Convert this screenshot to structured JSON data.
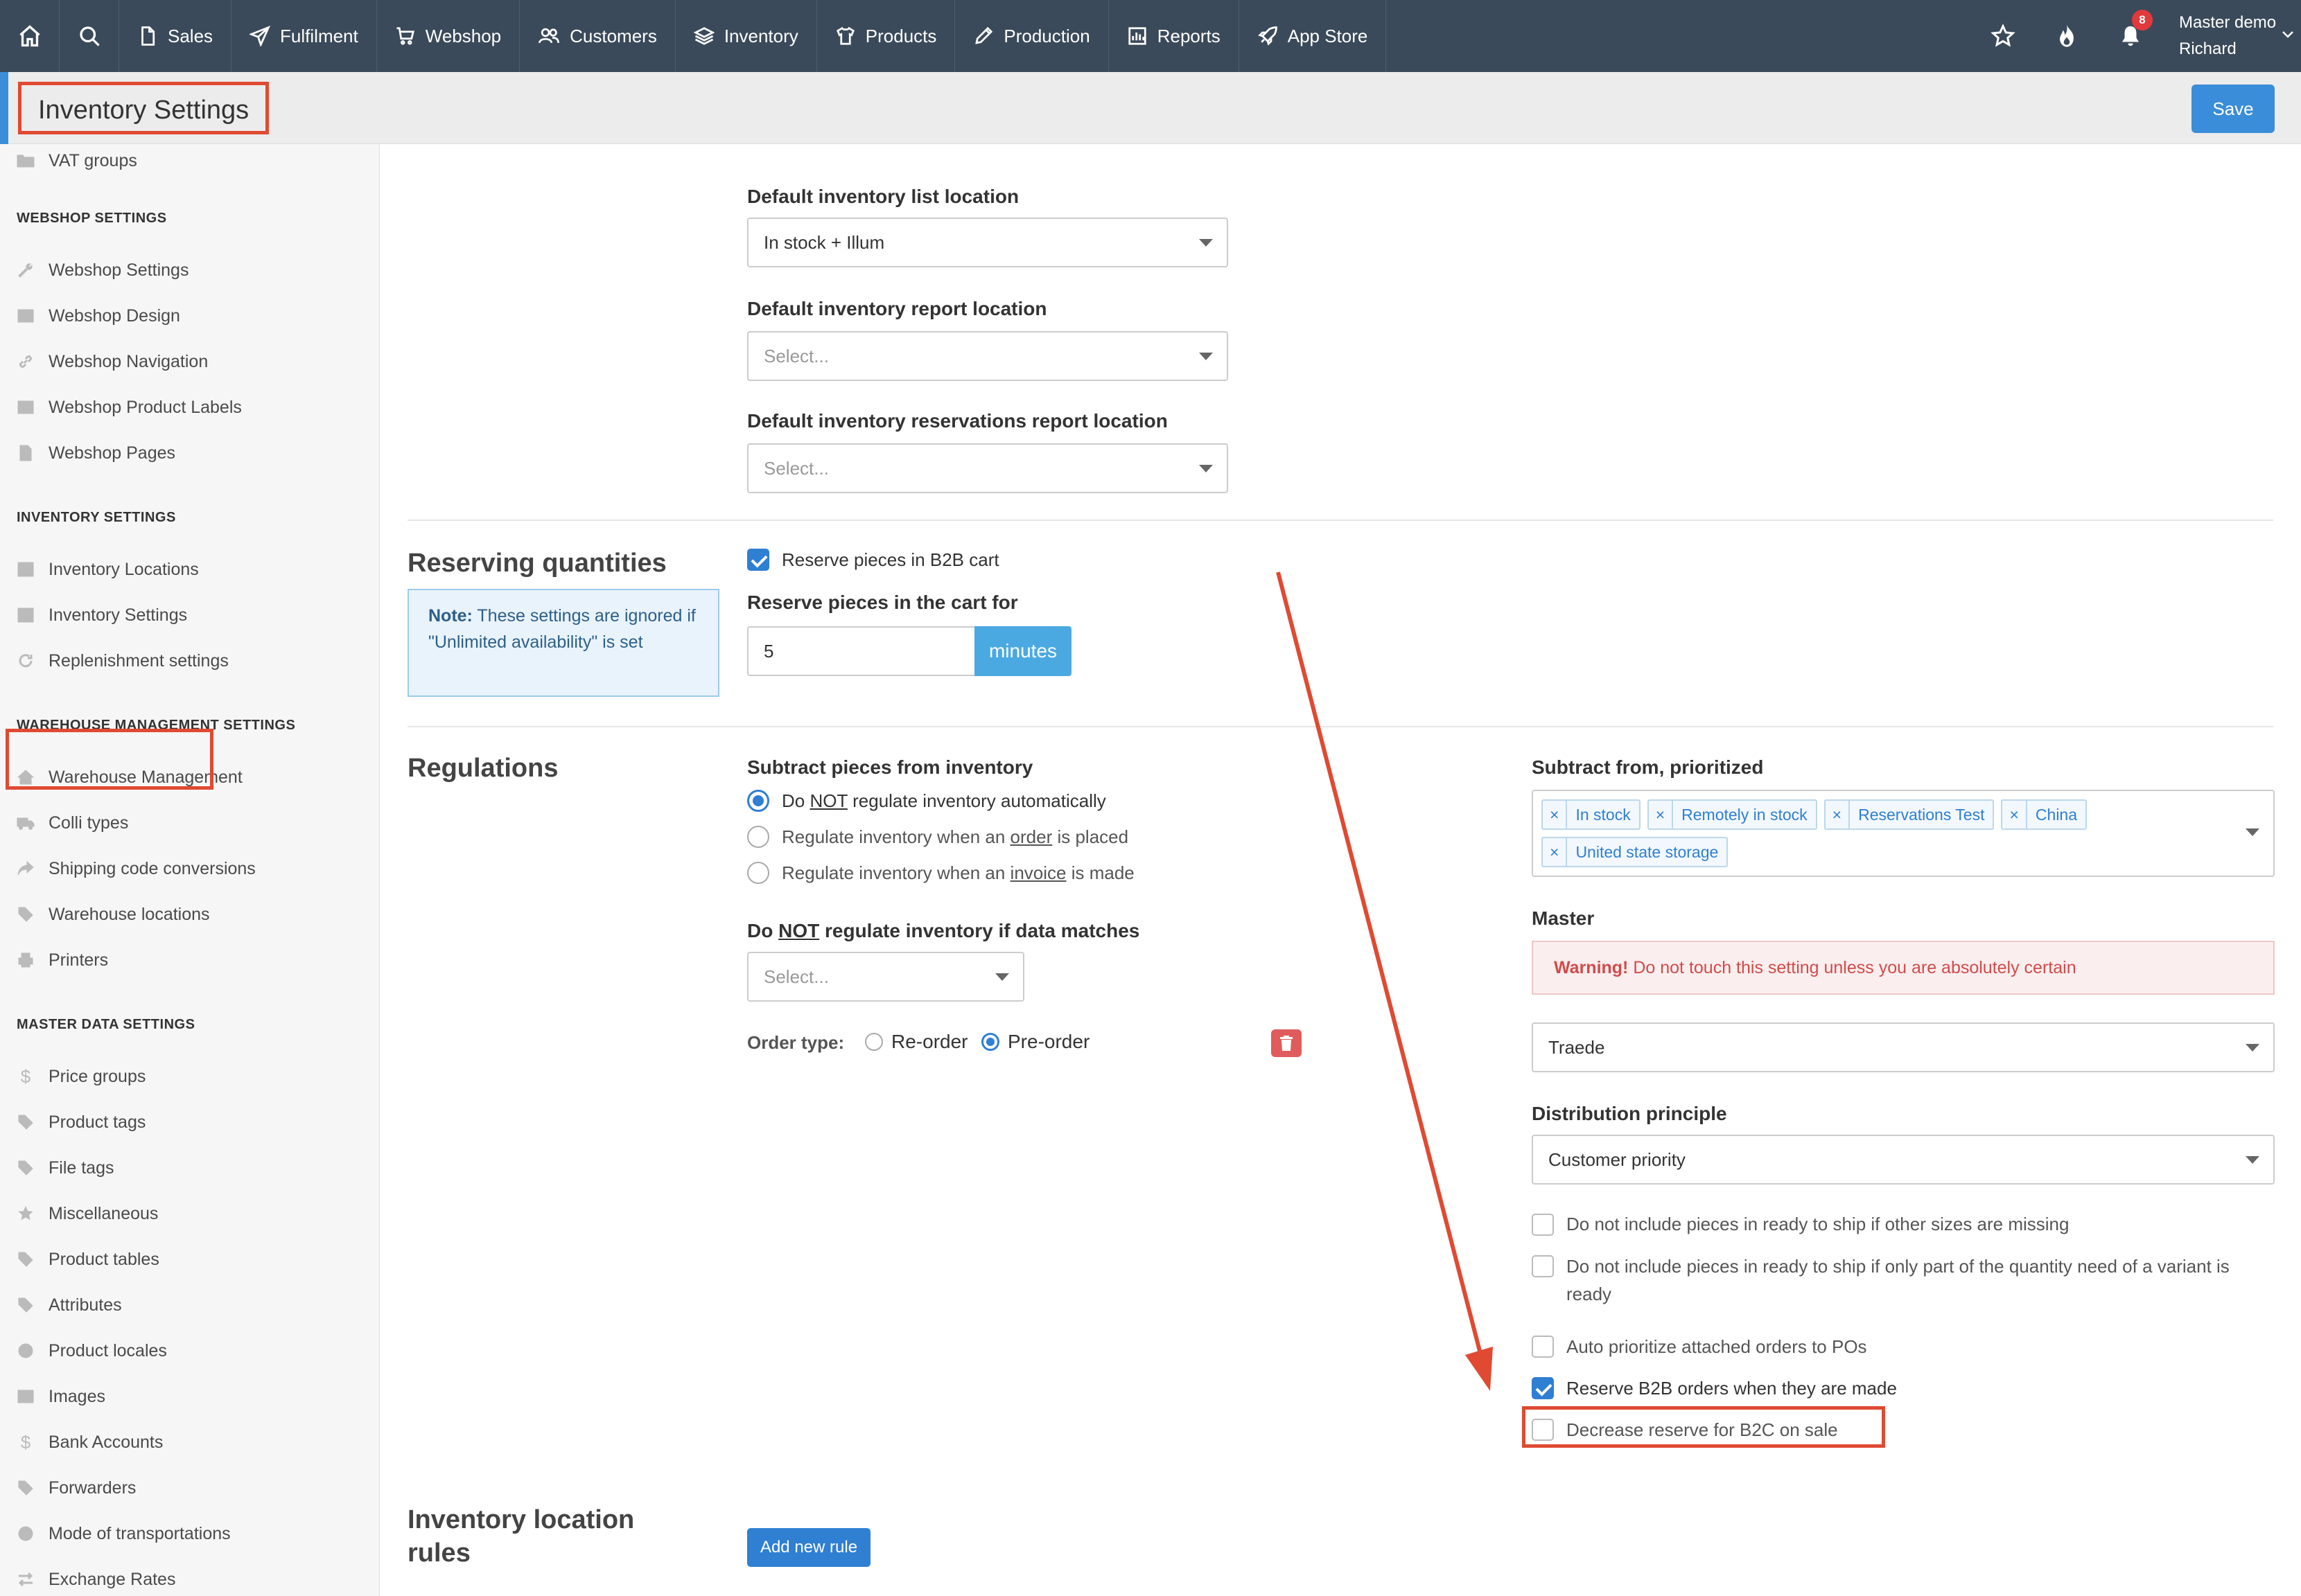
{
  "nav": {
    "items": [
      {
        "label": "Sales",
        "icon": "document-icon"
      },
      {
        "label": "Fulfilment",
        "icon": "send-icon"
      },
      {
        "label": "Webshop",
        "icon": "cart-icon"
      },
      {
        "label": "Customers",
        "icon": "users-icon"
      },
      {
        "label": "Inventory",
        "icon": "layers-icon"
      },
      {
        "label": "Products",
        "icon": "shirt-icon"
      },
      {
        "label": "Production",
        "icon": "pencil-icon"
      },
      {
        "label": "Reports",
        "icon": "report-icon"
      },
      {
        "label": "App Store",
        "icon": "rocket-icon"
      }
    ],
    "notification_count": "8",
    "user_line1": "Master demo",
    "user_line2": "Richard"
  },
  "header": {
    "title": "Inventory Settings",
    "save_label": "Save"
  },
  "sidebar": {
    "top_item": "VAT groups",
    "sections": [
      {
        "heading": "WEBSHOP SETTINGS",
        "items": [
          "Webshop Settings",
          "Webshop Design",
          "Webshop Navigation",
          "Webshop Product Labels",
          "Webshop Pages"
        ]
      },
      {
        "heading": "INVENTORY SETTINGS",
        "items": [
          "Inventory Locations",
          "Inventory Settings",
          "Replenishment settings"
        ]
      },
      {
        "heading": "WAREHOUSE MANAGEMENT SETTINGS",
        "items": [
          "Warehouse Management",
          "Colli types",
          "Shipping code conversions",
          "Warehouse locations",
          "Printers"
        ]
      },
      {
        "heading": "MASTER DATA SETTINGS",
        "items": [
          "Price groups",
          "Product tags",
          "File tags",
          "Miscellaneous",
          "Product tables",
          "Attributes",
          "Product locales",
          "Images",
          "Bank Accounts",
          "Forwarders",
          "Mode of transportations",
          "Exchange Rates"
        ]
      }
    ]
  },
  "locations": {
    "list_label": "Default inventory list location",
    "list_value": "In stock + Illum",
    "report_label": "Default inventory report location",
    "report_placeholder": "Select...",
    "reservations_label": "Default inventory reservations report location",
    "reservations_placeholder": "Select..."
  },
  "reserving": {
    "title": "Reserving quantities",
    "note_bold": "Note:",
    "note_text": "These settings are ignored if \"Unlimited availability\" is set",
    "checkbox_label": "Reserve pieces in B2B cart",
    "checkbox_checked": true,
    "cart_label": "Reserve pieces in the cart for",
    "cart_value": "5",
    "cart_unit": "minutes"
  },
  "regulations": {
    "title": "Regulations",
    "subtract_label": "Subtract pieces from inventory",
    "radio_1_pre": "Do ",
    "radio_1_u": "NOT",
    "radio_1_post": " regulate inventory automatically",
    "radio_2_pre": "Regulate inventory when an ",
    "radio_2_u": "order",
    "radio_2_post": " is placed",
    "radio_3_pre": "Regulate inventory when an ",
    "radio_3_u": "invoice",
    "radio_3_post": " is made",
    "donot_pre": "Do ",
    "donot_u": "NOT",
    "donot_post": " regulate inventory if data matches",
    "donot_placeholder": "Select...",
    "order_type_label": "Order type:",
    "order_type_opt1": "Re-order",
    "order_type_opt2": "Pre-order",
    "prioritized_label": "Subtract from, prioritized",
    "prioritized_tags": [
      "In stock",
      "Remotely in stock",
      "Reservations Test",
      "China",
      "United state storage"
    ],
    "master_label": "Master",
    "warning_bold": "Warning!",
    "warning_text": " Do not touch this setting unless you are absolutely certain",
    "master_value": "Traede",
    "distribution_label": "Distribution principle",
    "distribution_value": "Customer priority",
    "opt_1": "Do not include pieces in ready to ship if other sizes are missing",
    "opt_2": "Do not include pieces in ready to ship if only part of the quantity need of a variant is ready",
    "opt_3": "Auto prioritize attached orders to POs",
    "opt_4": "Reserve B2B orders when they are made",
    "opt_5": "Decrease reserve for B2C on sale"
  },
  "location_rules": {
    "title_line1": "Inventory location",
    "title_line2": "rules",
    "add_label": "Add new rule"
  },
  "colors": {
    "nav_bg": "#3b4a5a",
    "accent": "#2f7fd3",
    "highlight": "#e04a32",
    "warning": "#d24b4b"
  }
}
